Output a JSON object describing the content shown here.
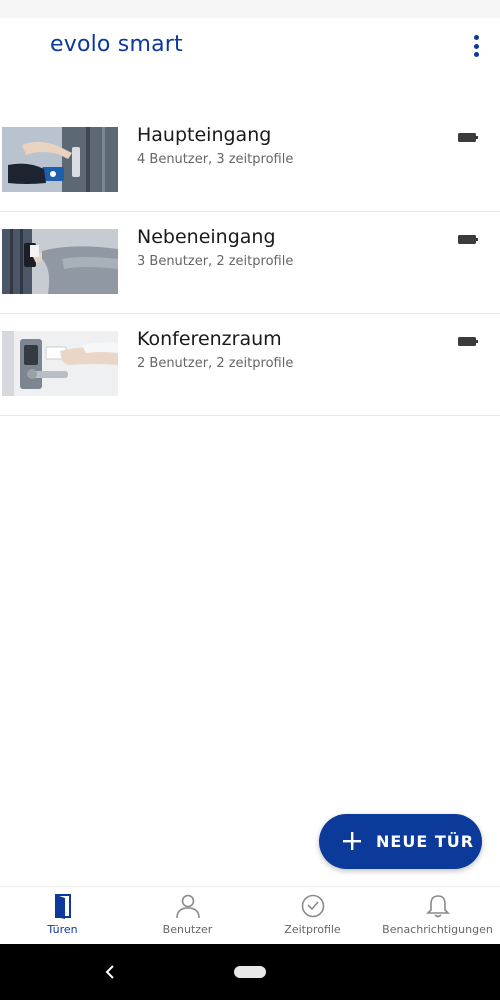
{
  "app_bar": {
    "title": "evolo smart",
    "overflow_icon": "more-vert-icon",
    "accent_color": "#0b3a9a"
  },
  "doors": [
    {
      "name": "Haupteingang",
      "subtitle": "4 Benutzer, 3 zeitprofile",
      "image": "door-handle-card-photo",
      "battery_icon": "battery-icon"
    },
    {
      "name": "Nebeneingang",
      "subtitle": "3 Benutzer, 2 zeitprofile",
      "image": "card-reader-photo",
      "battery_icon": "battery-icon"
    },
    {
      "name": "Konferenzraum",
      "subtitle": "2 Benutzer, 2 zeitprofile",
      "image": "door-lever-card-photo",
      "battery_icon": "battery-icon"
    }
  ],
  "fab": {
    "label": "NEUE TÜR",
    "icon": "plus-icon"
  },
  "bottom_nav": [
    {
      "label": "Türen",
      "icon": "door-icon",
      "active": true
    },
    {
      "label": "Benutzer",
      "icon": "user-icon",
      "active": false
    },
    {
      "label": "Zeitprofile",
      "icon": "clock-icon",
      "active": false
    },
    {
      "label": "Benachrichtigungen",
      "icon": "bell-icon",
      "active": false
    }
  ]
}
